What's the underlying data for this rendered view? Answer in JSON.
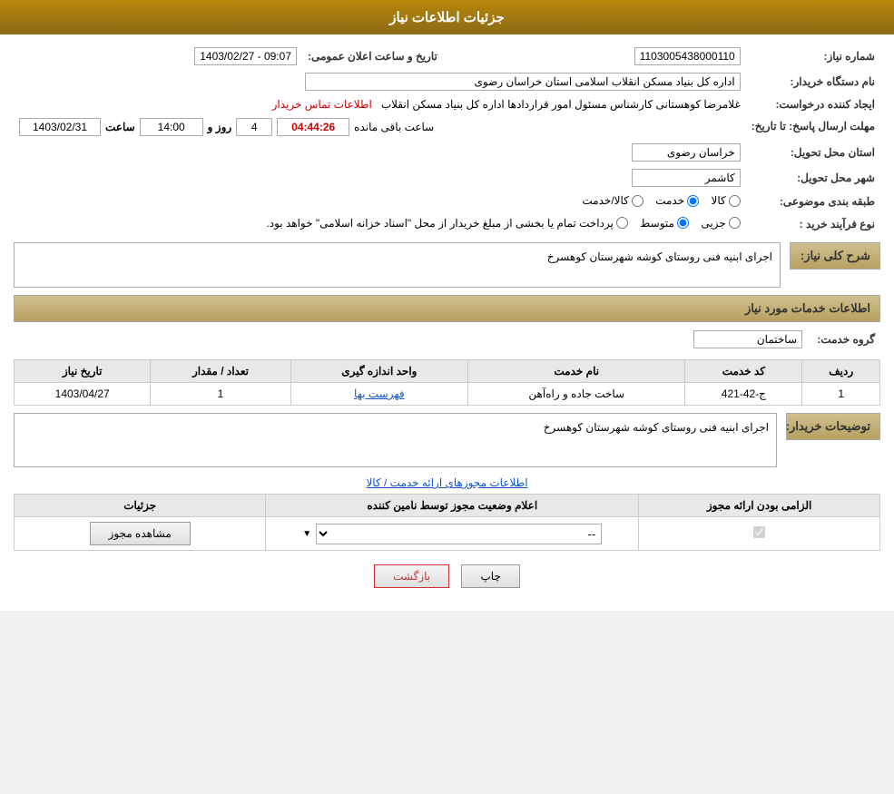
{
  "header": {
    "title": "جزئیات اطلاعات نیاز"
  },
  "fields": {
    "shomareNiaz_label": "شماره نیاز:",
    "shomareNiaz_value": "1103005438000110",
    "namDastgah_label": "نام دستگاه خریدار:",
    "namDastgah_value": "اداره کل بنیاد مسکن انقلاب اسلامی استان خراسان رضوی",
    "ijadKonande_label": "ایجاد کننده درخواست:",
    "ijadKonande_name": "غلامرضا کوهستانی کارشناس مسئول امور قراردادها اداره کل بنیاد مسکن انقلاب",
    "ijadKonande_link": "اطلاعات تماس خریدار",
    "mohlatErsalPasakh_label": "مهلت ارسال پاسخ: تا تاریخ:",
    "tarikh_date": "1403/02/31",
    "tarikh_saat_label": "ساعت",
    "tarikh_saat": "14:00",
    "tarikh_rooz_label": "روز و",
    "tarikh_rooz": "4",
    "tarikh_countdown": "04:44:26",
    "tarikh_remaining_label": "ساعت باقی مانده",
    "tarikh_public_label": "تاریخ و ساعت اعلان عمومی:",
    "tarikh_public_value": "1403/02/27 - 09:07",
    "ostanTahvil_label": "استان محل تحویل:",
    "ostanTahvil_value": "خراسان رضوی",
    "shahrTahvil_label": "شهر محل تحویل:",
    "shahrTahvil_value": "کاشمر",
    "tabaqebandiMozouee_label": "طبقه بندی موضوعی:",
    "tabaqebandiMozouee_options": [
      {
        "label": "کالا",
        "selected": false
      },
      {
        "label": "خدمت",
        "selected": true
      },
      {
        "label": "کالا/خدمت",
        "selected": false
      }
    ],
    "noeFarayandKharid_label": "نوع فرآیند خرید :",
    "noeFarayandKharid_options": [
      {
        "label": "جزیی",
        "selected": false
      },
      {
        "label": "متوسط",
        "selected": true
      },
      {
        "label": "پرداخت تمام یا بخشی از مبلغ خریدار از محل \"اسناد خزانه اسلامی\" خواهد بود.",
        "selected": false
      }
    ]
  },
  "sharh": {
    "title": "شرح کلی نیاز:",
    "value": "اجرای ابنیه فنی روستای کوشه شهرستان کوهسرخ"
  },
  "khadamat": {
    "title": "اطلاعات خدمات مورد نیاز",
    "grohe_label": "گروه خدمت:",
    "grohe_value": "ساختمان",
    "table": {
      "headers": [
        "ردیف",
        "کد خدمت",
        "نام خدمت",
        "واحد اندازه گیری",
        "تعداد / مقدار",
        "تاریخ نیاز"
      ],
      "rows": [
        {
          "radif": "1",
          "kodKhedmat": "ج-42-421",
          "namKhedmat": "ساخت جاده و راه‌آهن",
          "vahed": "فهرست بها",
          "tedad": "1",
          "tarikh": "1403/04/27"
        }
      ]
    }
  },
  "tozihat": {
    "label": "توضیحات خریدار:",
    "value": "اجرای ابنیه فنی روستای کوشه شهرستان کوهسرخ"
  },
  "permits": {
    "link_label": "اطلاعات مجوزهای ارائه خدمت / کالا",
    "table": {
      "headers": [
        "الزامی بودن ارائه مجوز",
        "اعلام وضعیت مجوز توسط نامین کننده",
        "جزئیات"
      ],
      "rows": [
        {
          "elzami": true,
          "status": "--",
          "detail_btn": "مشاهده مجوز"
        }
      ]
    }
  },
  "buttons": {
    "print": "چاپ",
    "back": "بازگشت"
  }
}
